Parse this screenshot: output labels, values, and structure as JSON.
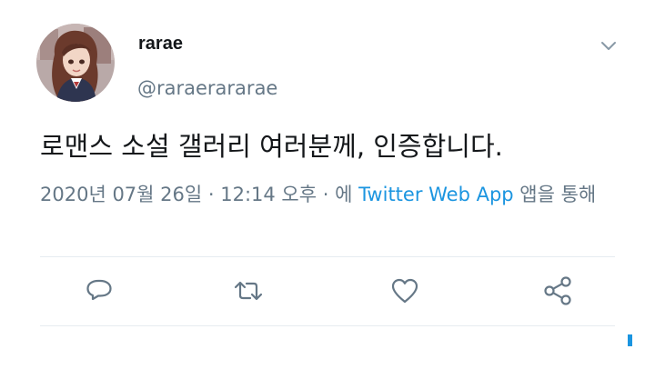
{
  "tweet": {
    "display_name": "rarae",
    "handle": "@raraerararae",
    "text": "로맨스 소설 갤러리 여러분께, 인증합니다.",
    "timestamp": "2020년 07월 26일 · 12:14 오후 · 에 ",
    "source_app": "Twitter Web App",
    "source_suffix": " 앱을 통해"
  },
  "icons": {
    "more": "chevron-down-icon",
    "reply": "reply-bubble-icon",
    "retweet": "retweet-icon",
    "like": "heart-icon",
    "share": "share-icon"
  },
  "colors": {
    "text_primary": "#14171a",
    "text_secondary": "#657786",
    "link": "#1b95e0",
    "divider": "#e6ecf0"
  }
}
